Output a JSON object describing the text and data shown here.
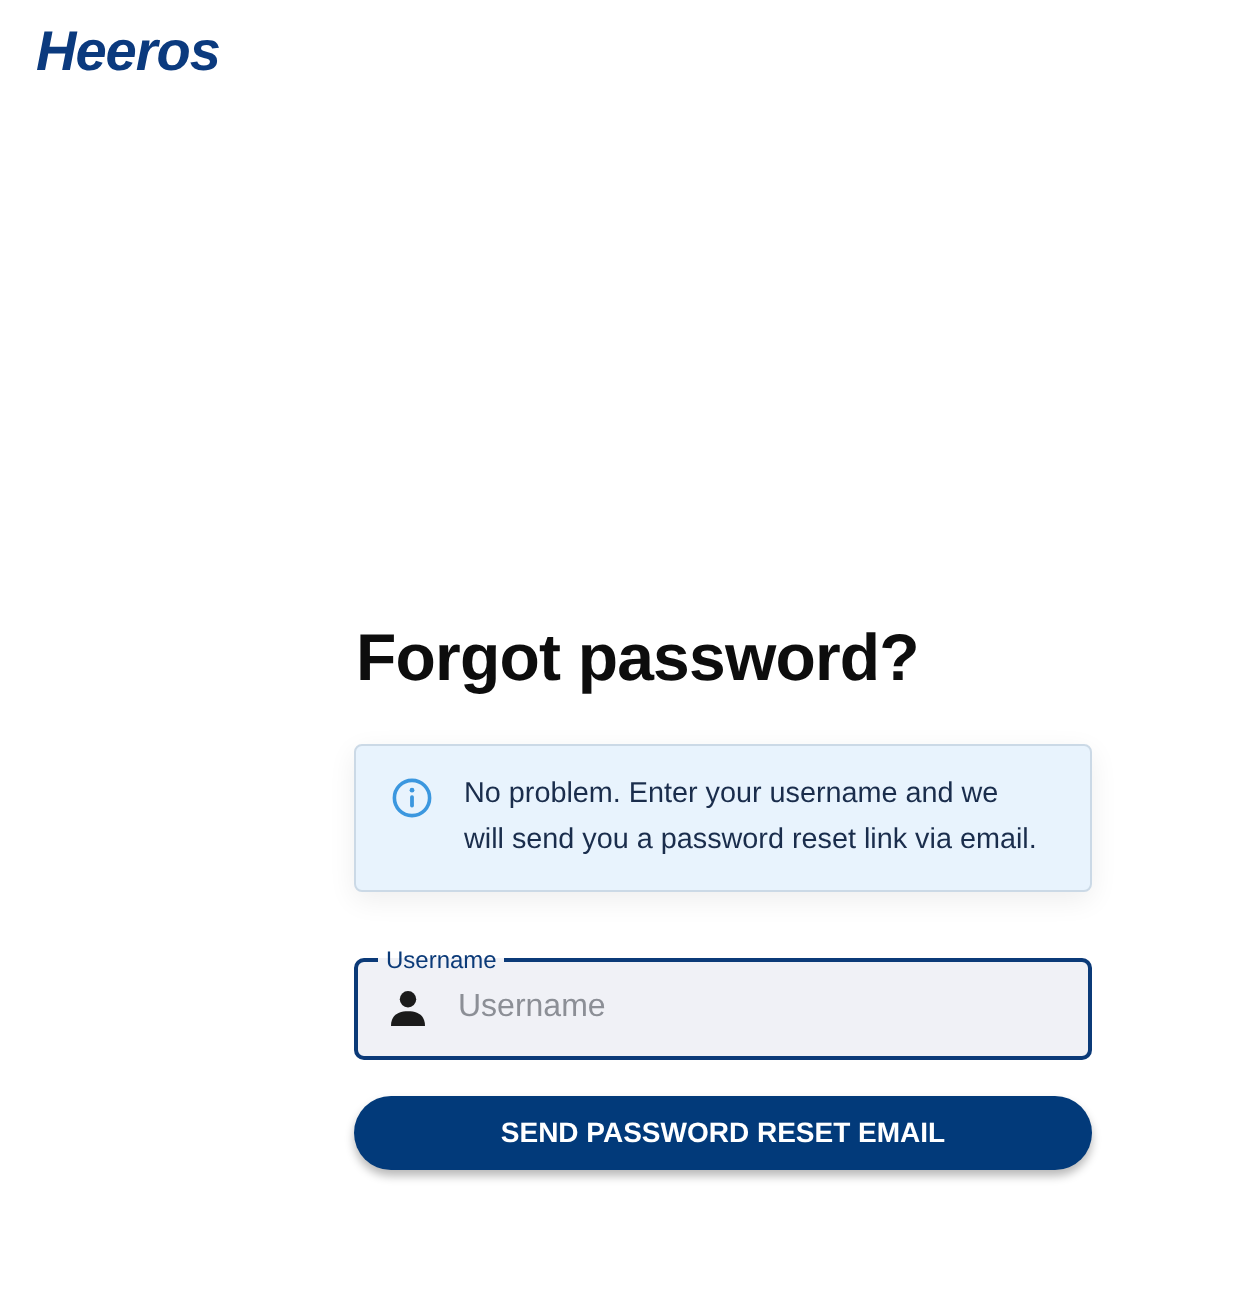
{
  "logo": {
    "text": "Heeros"
  },
  "heading": "Forgot password?",
  "alert": {
    "kind": "info",
    "text": "No problem. Enter your username and we will send you a password reset link via email."
  },
  "username_field": {
    "label": "Username",
    "placeholder": "Username"
  },
  "submit_button": {
    "label": "SEND PASSWORD RESET EMAIL"
  }
}
